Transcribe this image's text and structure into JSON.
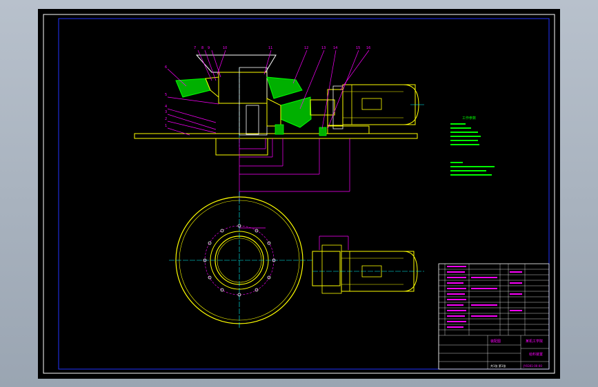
{
  "title_block": {
    "company": "某机工学院",
    "drawing_title": "给料装置",
    "drawing_type": "装配图",
    "drawing_no": "JY0301-00-00",
    "sheet": "共1张 第1张"
  },
  "specs_title": "工作参数",
  "callouts": [
    "7",
    "8",
    "9",
    "10",
    "11",
    "12",
    "13",
    "14",
    "15",
    "16",
    "6",
    "5",
    "4",
    "3",
    "2",
    "1"
  ],
  "colors": {
    "background": "#000000",
    "frame": "#ffffff",
    "outline": "#ffff00",
    "dimension": "#ff00ff",
    "hatch": "#00ff00",
    "center": "#00ffff",
    "motor": "#ffff00"
  }
}
